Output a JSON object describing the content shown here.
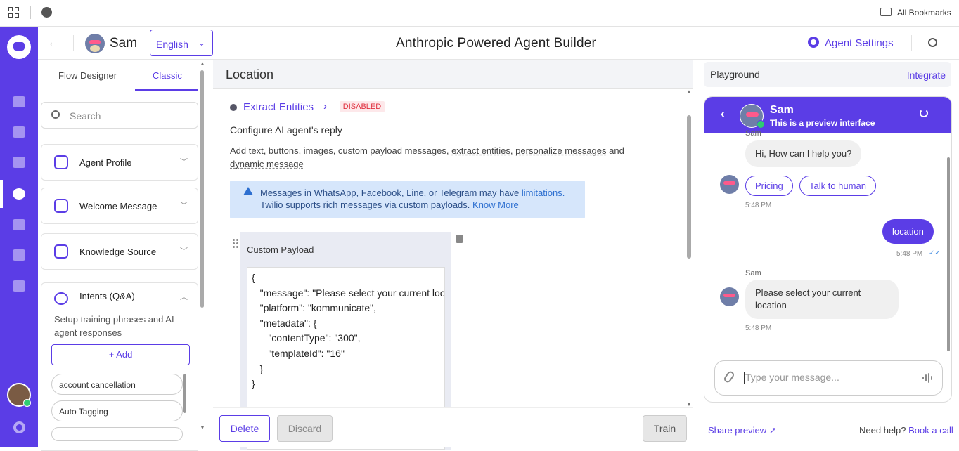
{
  "browser": {
    "bookmarks_label": "All Bookmarks"
  },
  "header": {
    "bot_name": "Sam",
    "language": "English",
    "title": "Anthropic Powered Agent Builder",
    "agent_settings": "Agent Settings"
  },
  "left_panel": {
    "tabs": [
      "Flow Designer",
      "Classic"
    ],
    "active_tab": "Classic",
    "search_placeholder": "Search",
    "sections": [
      {
        "title": "Agent Profile",
        "icon": "agent-profile-icon"
      },
      {
        "title": "Welcome Message",
        "icon": "wave-hand-icon"
      },
      {
        "title": "Knowledge Source",
        "icon": "database-icon"
      }
    ],
    "intents": {
      "title": "Intents (Q&A)",
      "description": "Setup training phrases and AI agent responses",
      "add_label": "+ Add",
      "items": [
        "account cancellation",
        "Auto Tagging"
      ]
    }
  },
  "center": {
    "title": "Location",
    "extract_entities": "Extract Entities",
    "status_badge": "DISABLED",
    "configure_label": "Configure AI agent's reply",
    "help_text_prefix": "Add text, buttons, images, custom payload messages,",
    "help_link_1": "extract entities",
    "help_link_2": "personalize messages",
    "help_text_and": "and",
    "help_link_3": "dynamic message",
    "alert_line1": "Messages in WhatsApp, Facebook, Line, or Telegram may have",
    "alert_link1": "limitations.",
    "alert_line2": "Twilio supports rich messages via custom payloads.",
    "alert_link2": "Know More",
    "payload_title": "Custom Payload",
    "payload_lines": [
      "{",
      "   \"message\": \"Please select your current location\",",
      "   \"platform\": \"kommunicate\",",
      "   \"metadata\": {",
      "      \"contentType\": \"300\",",
      "      \"templateId\": \"16\"",
      "   }",
      "}"
    ],
    "buttons": {
      "delete": "Delete",
      "discard": "Discard",
      "train": "Train"
    }
  },
  "playground": {
    "title": "Playground",
    "integrate": "Integrate",
    "chat": {
      "name": "Sam",
      "subtitle": "This is a preview interface",
      "sender_top": "Sam",
      "messages": [
        {
          "from": "bot",
          "text": "Hi, How can I help you?"
        },
        {
          "from": "bot",
          "quick_replies": [
            "Pricing",
            "Talk to human"
          ],
          "time": "5:48 PM"
        },
        {
          "from": "user",
          "text": "location",
          "time": "5:48 PM"
        },
        {
          "from": "bot",
          "sender": "Sam",
          "text": "Please select your current location",
          "time": "5:48 PM"
        }
      ],
      "input_placeholder": "Type your message..."
    },
    "share_preview": "Share preview",
    "need_help": "Need help?",
    "book_call": "Book a call"
  },
  "colors": {
    "brand": "#5b3de6",
    "disabled_badge_bg": "#fde8ea",
    "disabled_badge_text": "#e0303f",
    "alert_bg": "#d6e6fb"
  }
}
